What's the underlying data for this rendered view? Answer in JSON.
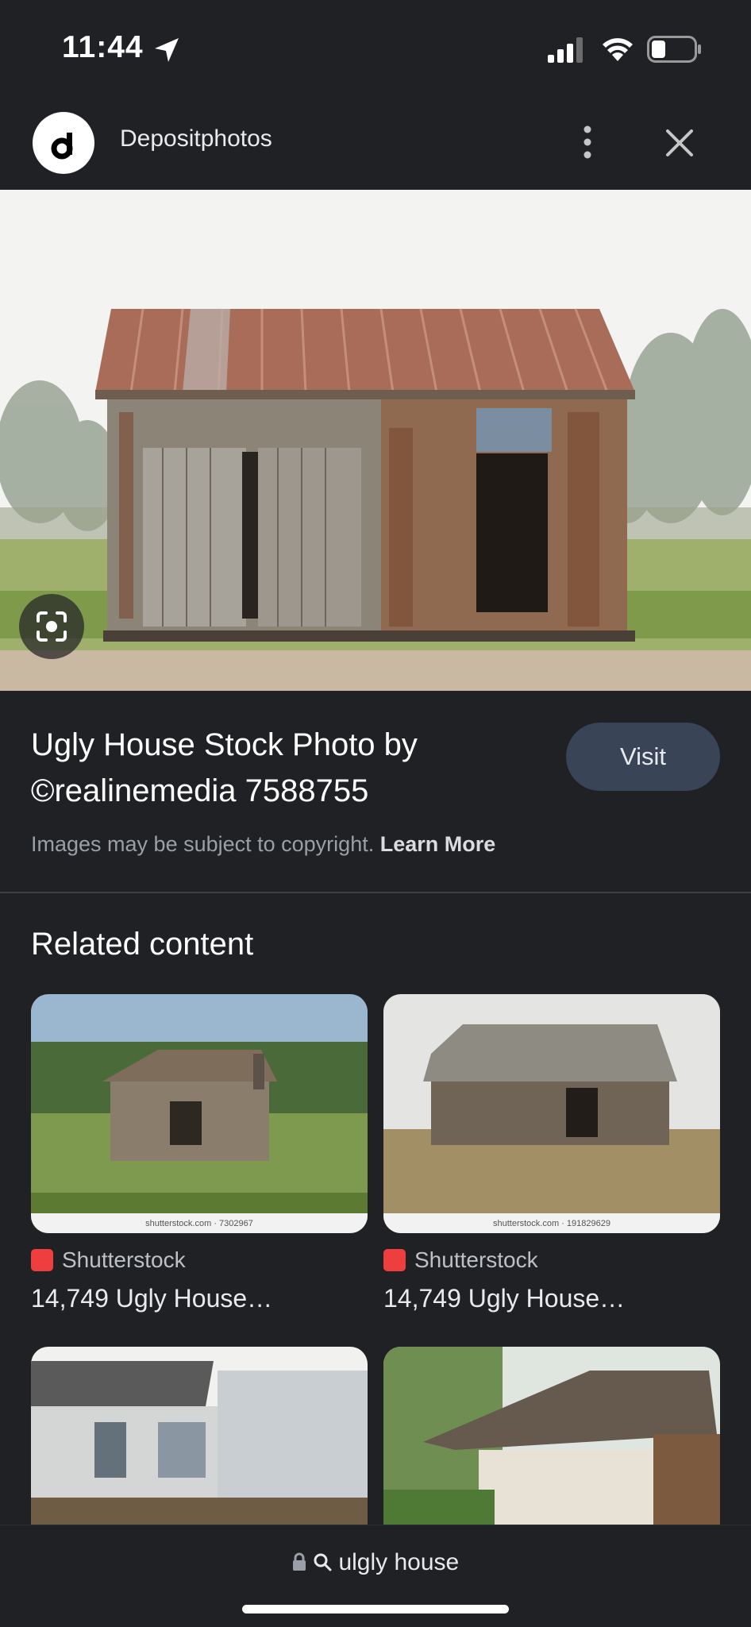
{
  "status_bar": {
    "time": "11:44"
  },
  "header": {
    "site_name": "Depositphotos"
  },
  "image_result": {
    "title": "Ugly House Stock Photo by ©realinemedia 7588755",
    "visit_label": "Visit",
    "copyright_text": "Images may be subject to copyright.",
    "learn_more": "Learn More"
  },
  "related": {
    "heading": "Related content",
    "items": [
      {
        "source": "Shutterstock",
        "title": "14,749 Ugly House…",
        "watermark": "shutterstock.com · 7302967"
      },
      {
        "source": "Shutterstock",
        "title": "14,749 Ugly House…",
        "watermark": "shutterstock.com · 191829629"
      },
      {
        "source": "",
        "title": "",
        "watermark": ""
      },
      {
        "source": "",
        "title": "",
        "watermark": ""
      }
    ]
  },
  "search": {
    "query": "ulgly house"
  },
  "colors": {
    "background": "#202124",
    "visit_button": "#394457",
    "shutterstock_red": "#ee3e3e"
  }
}
